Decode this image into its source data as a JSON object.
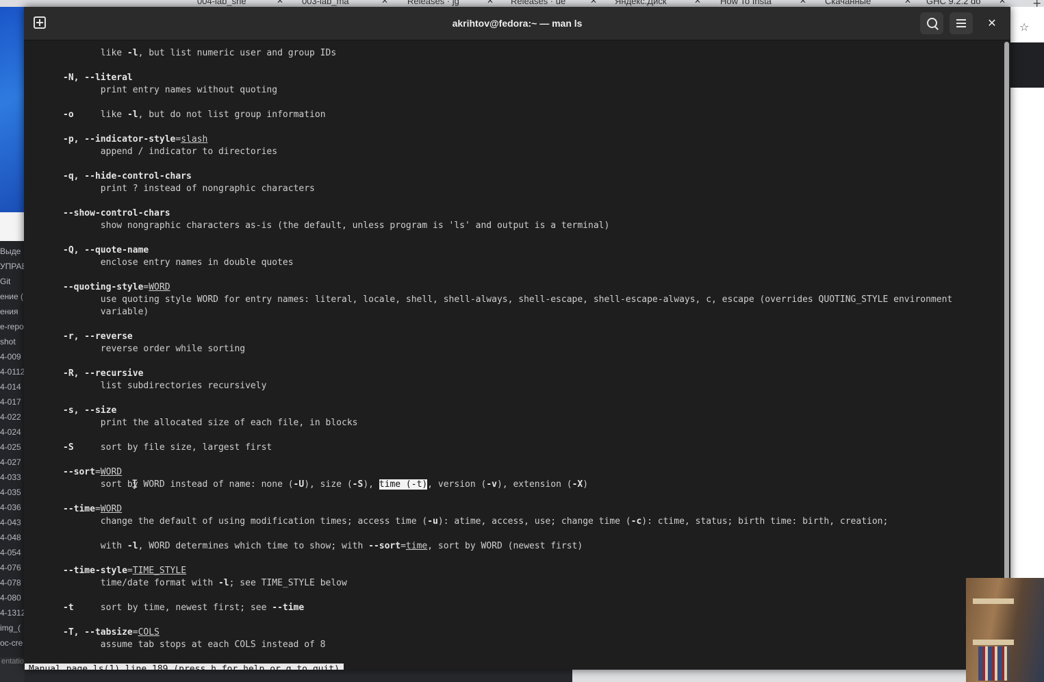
{
  "browser": {
    "tabs": [
      "004-lab_she",
      "003-lab_ma",
      "Releases · jg",
      "Releases · ue",
      "Яндекс.Диск",
      "How To Insta",
      "Скачанные",
      "GHC 9.2.2 do"
    ]
  },
  "sidebar_fragments": [
    "Выде",
    "УПРАВ",
    "Git",
    "ение (",
    "ения",
    "e-repo",
    "shot",
    "4-009",
    "4-0112",
    "4-014",
    "4-017",
    "4-022",
    "4-024",
    "4-025",
    "4-027",
    "4-033",
    "4-035",
    "4-036",
    "4-043",
    "4-048",
    "4-054",
    "4-076",
    "4-078",
    "4-080",
    "4-1312",
    "img_(",
    "oc-cre",
    "entation.md presentation"
  ],
  "terminal": {
    "title": "akrihtov@fedora:~ — man ls",
    "status": "Manual page ls(1) line 189 (press h for help or q to quit)",
    "lines": [
      [
        {
          "t": "       like "
        },
        {
          "t": "-l",
          "s": "b"
        },
        {
          "t": ", but list numeric user and group IDs"
        }
      ],
      [
        {
          "t": "-N, --literal",
          "s": "b"
        }
      ],
      [
        {
          "t": "       print entry names without quoting"
        }
      ],
      [
        {
          "t": "-o",
          "s": "b"
        },
        {
          "t": "     like "
        },
        {
          "t": "-l",
          "s": "b"
        },
        {
          "t": ", but do not list group information"
        }
      ],
      [
        {
          "t": "-p, --indicator-style",
          "s": "b"
        },
        {
          "t": "="
        },
        {
          "t": "slash",
          "s": "u"
        }
      ],
      [
        {
          "t": "       append / indicator to directories"
        }
      ],
      [
        {
          "t": "-q, --hide-control-chars",
          "s": "b"
        }
      ],
      [
        {
          "t": "       print ? instead of nongraphic characters"
        }
      ],
      [
        {
          "t": "--show-control-chars",
          "s": "b"
        }
      ],
      [
        {
          "t": "       show nongraphic characters as-is (the default, unless program is 'ls' and output is a terminal)"
        }
      ],
      [
        {
          "t": "-Q, --quote-name",
          "s": "b"
        }
      ],
      [
        {
          "t": "       enclose entry names in double quotes"
        }
      ],
      [
        {
          "t": "--quoting-style",
          "s": "b"
        },
        {
          "t": "="
        },
        {
          "t": "WORD",
          "s": "u"
        }
      ],
      [
        {
          "t": "       use quoting style WORD for entry names: literal, locale, shell, shell-always, shell-escape, shell-escape-always, c, escape (overrides QUOTING_STYLE environment"
        }
      ],
      [
        {
          "t": "       variable)"
        }
      ],
      [
        {
          "t": "-r, --reverse",
          "s": "b"
        }
      ],
      [
        {
          "t": "       reverse order while sorting"
        }
      ],
      [
        {
          "t": "-R, --recursive",
          "s": "b"
        }
      ],
      [
        {
          "t": "       list subdirectories recursively"
        }
      ],
      [
        {
          "t": "-s, --size",
          "s": "b"
        }
      ],
      [
        {
          "t": "       print the allocated size of each file, in blocks"
        }
      ],
      [
        {
          "t": "-S",
          "s": "b"
        },
        {
          "t": "     sort by file size, largest first"
        }
      ],
      [
        {
          "t": "--sort",
          "s": "b"
        },
        {
          "t": "="
        },
        {
          "t": "WORD",
          "s": "u"
        }
      ],
      [
        {
          "t": "       sort by WORD instead of name: none ("
        },
        {
          "t": "-U",
          "s": "b"
        },
        {
          "t": "), size ("
        },
        {
          "t": "-S",
          "s": "b"
        },
        {
          "t": "), "
        },
        {
          "t": "time (-t)",
          "s": "hl"
        },
        {
          "t": ", version ("
        },
        {
          "t": "-v",
          "s": "b"
        },
        {
          "t": "), extension ("
        },
        {
          "t": "-X",
          "s": "b"
        },
        {
          "t": ")"
        }
      ],
      [
        {
          "t": "--time",
          "s": "b"
        },
        {
          "t": "="
        },
        {
          "t": "WORD",
          "s": "u"
        }
      ],
      [
        {
          "t": "       change the default of using modification times; access time ("
        },
        {
          "t": "-u",
          "s": "b"
        },
        {
          "t": "): atime, access, use; change time ("
        },
        {
          "t": "-c",
          "s": "b"
        },
        {
          "t": "): ctime, status; birth time: birth, creation;"
        }
      ],
      [
        {
          "t": "       with "
        },
        {
          "t": "-l",
          "s": "b"
        },
        {
          "t": ", WORD determines which time to show; with "
        },
        {
          "t": "--sort",
          "s": "b"
        },
        {
          "t": "="
        },
        {
          "t": "time",
          "s": "u"
        },
        {
          "t": ", sort by WORD (newest first)"
        }
      ],
      [
        {
          "t": "--time-style",
          "s": "b"
        },
        {
          "t": "="
        },
        {
          "t": "TIME_STYLE",
          "s": "u"
        }
      ],
      [
        {
          "t": "       time/date format with "
        },
        {
          "t": "-l",
          "s": "b"
        },
        {
          "t": "; see TIME_STYLE below"
        }
      ],
      [
        {
          "t": "-t",
          "s": "b"
        },
        {
          "t": "     sort by time, newest first; see "
        },
        {
          "t": "--time",
          "s": "b"
        }
      ],
      [
        {
          "t": "-T, --tabsize",
          "s": "b"
        },
        {
          "t": "="
        },
        {
          "t": "COLS",
          "s": "u"
        }
      ],
      [
        {
          "t": "       assume tab stops at each COLS instead of 8"
        }
      ]
    ]
  },
  "colors": {
    "terminal_bg": "#1e1e1e",
    "titlebar_bg": "#2b2b2b",
    "text": "#cfcfcf",
    "highlight_bg": "#f2f2f2"
  },
  "icons": {
    "new_tab": "new-tab-icon",
    "search": "search-icon",
    "menu": "hamburger-icon",
    "close": "close-icon",
    "star": "star-icon"
  }
}
